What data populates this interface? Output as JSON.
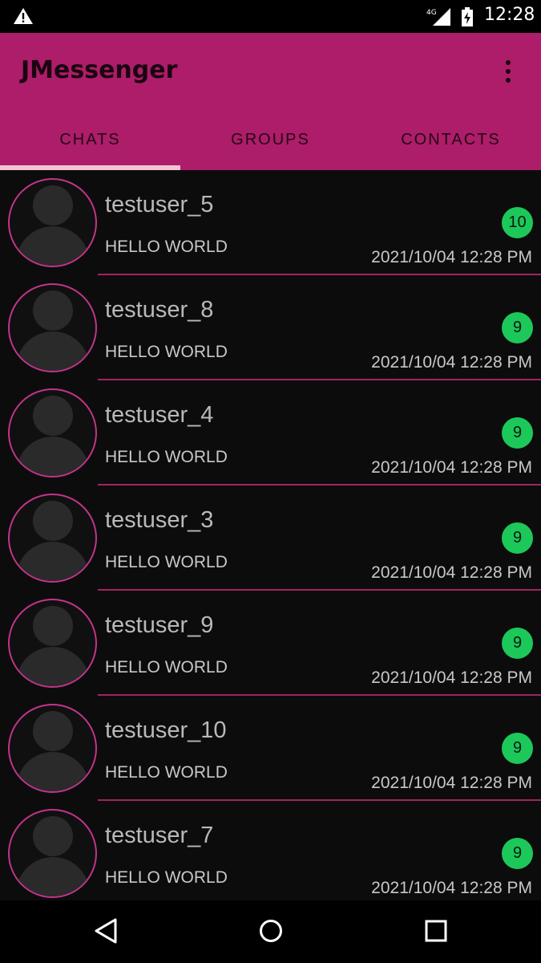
{
  "status_bar": {
    "time": "12:28",
    "network": "4G",
    "icons": [
      "warning-icon",
      "signal-icon",
      "battery-charging-icon"
    ]
  },
  "app_bar": {
    "title": "JMessenger",
    "menu_icon": "more-vert-icon",
    "background": "#ad1d69"
  },
  "tabs": [
    {
      "label": "CHATS",
      "selected": true
    },
    {
      "label": "GROUPS",
      "selected": false
    },
    {
      "label": "CONTACTS",
      "selected": false
    }
  ],
  "chats": [
    {
      "name": "testuser_5",
      "message": "HELLO WORLD",
      "time": "2021/10/04 12:28 PM",
      "unread": "10"
    },
    {
      "name": "testuser_8",
      "message": "HELLO WORLD",
      "time": "2021/10/04 12:28 PM",
      "unread": "9"
    },
    {
      "name": "testuser_4",
      "message": "HELLO WORLD",
      "time": "2021/10/04 12:28 PM",
      "unread": "9"
    },
    {
      "name": "testuser_3",
      "message": "HELLO WORLD",
      "time": "2021/10/04 12:28 PM",
      "unread": "9"
    },
    {
      "name": "testuser_9",
      "message": "HELLO WORLD",
      "time": "2021/10/04 12:28 PM",
      "unread": "9"
    },
    {
      "name": "testuser_10",
      "message": "HELLO WORLD",
      "time": "2021/10/04 12:28 PM",
      "unread": "9"
    },
    {
      "name": "testuser_7",
      "message": "HELLO WORLD",
      "time": "2021/10/04 12:28 PM",
      "unread": "9"
    }
  ],
  "colors": {
    "accent": "#ad1d69",
    "badge": "#1cc85a",
    "avatar_ring": "#c2348a"
  },
  "nav_bar": {
    "icons": [
      "back-icon",
      "home-icon",
      "recents-icon"
    ]
  }
}
